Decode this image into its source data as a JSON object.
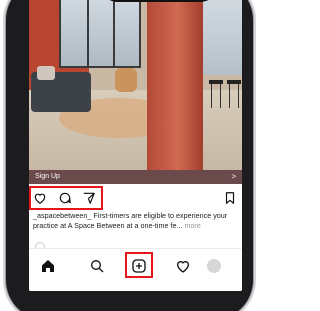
{
  "ad": {
    "cta_label": "Sign Up",
    "cta_arrow": ">"
  },
  "post": {
    "username": "_aspacebetween_",
    "caption": " First-timers are eligible to experience your practice at A Space Between at a one-time fe... ",
    "more_label": "more"
  },
  "actions": {
    "icons": [
      "heart-icon",
      "comment-icon",
      "share-icon",
      "bookmark-icon"
    ]
  },
  "tabbar": {
    "icons": [
      "home-icon",
      "search-icon",
      "create-post-icon",
      "activity-icon",
      "profile-avatar"
    ],
    "highlighted": "create-post-icon"
  },
  "colors": {
    "highlight": "#e8141c",
    "cta_bar": "#6b4a4c",
    "wall": "#b7452f",
    "pillar": "#c45a44"
  }
}
